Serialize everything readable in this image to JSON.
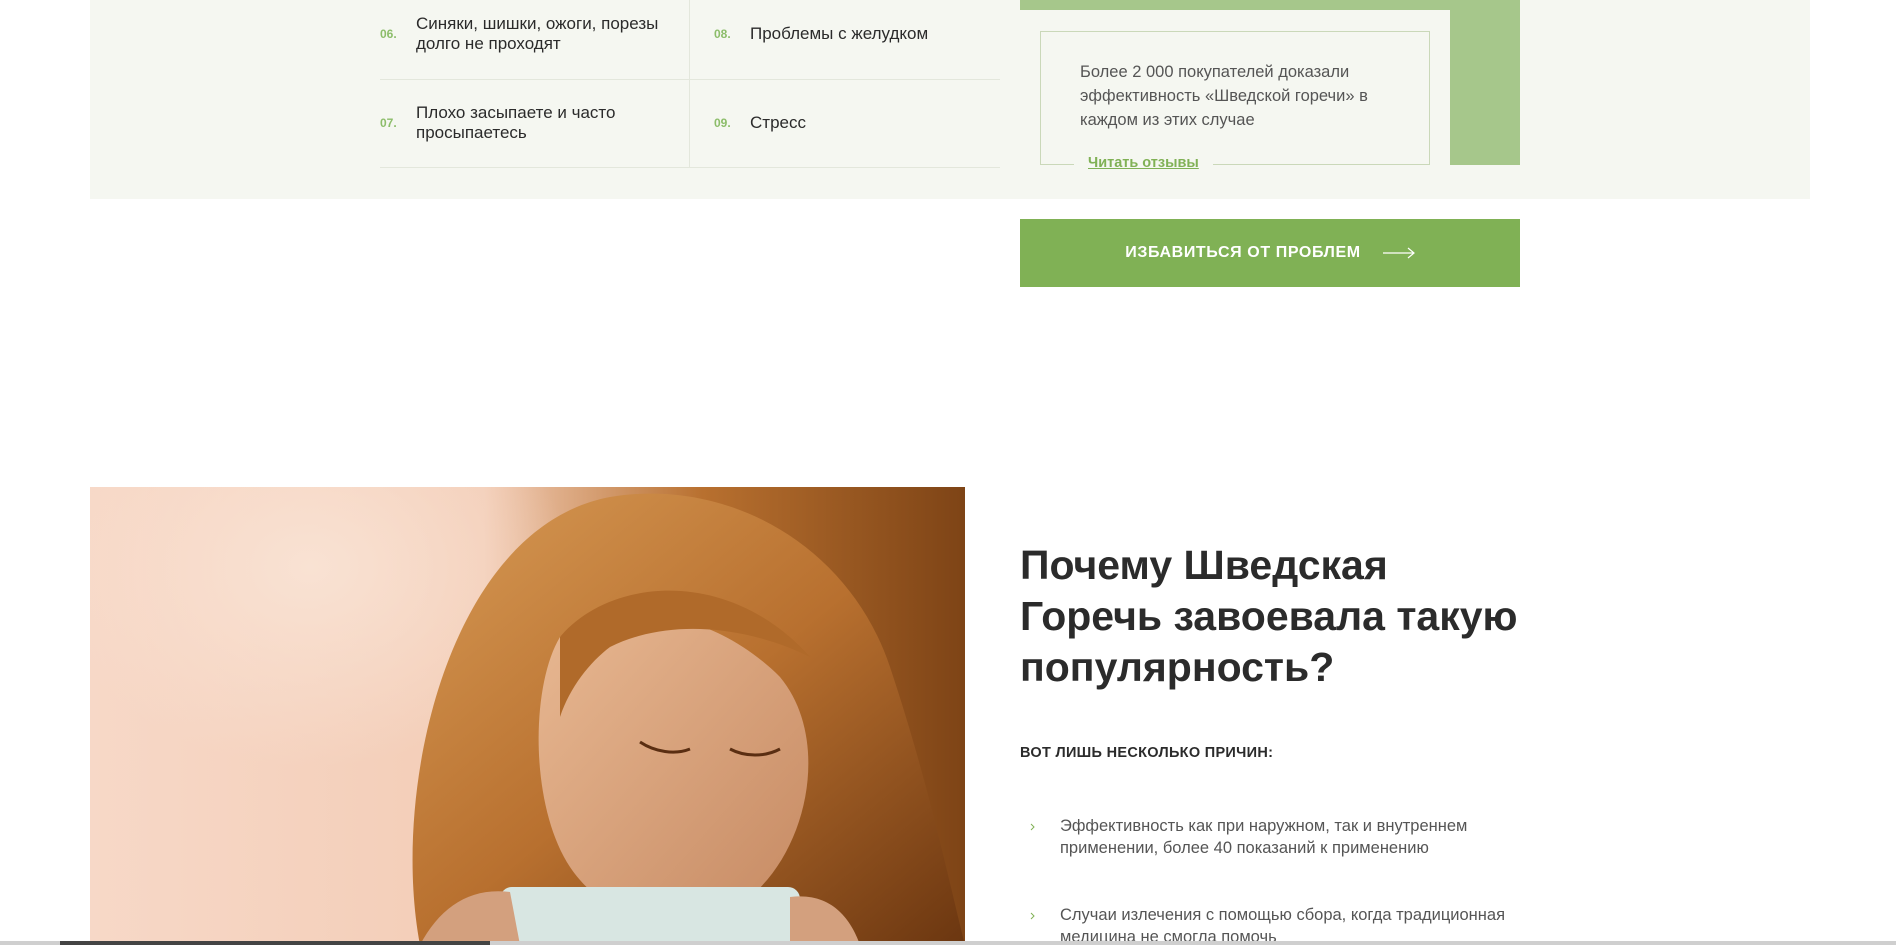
{
  "problems": [
    {
      "num": "06.",
      "text": "Синяки, шишки, ожоги, порезы долго не проходят"
    },
    {
      "num": "07.",
      "text": "Плохо засыпаете и часто просыпаетесь"
    },
    {
      "num": "08.",
      "text": "Проблемы с желудком"
    },
    {
      "num": "09.",
      "text": "Стресс"
    }
  ],
  "testimonial": {
    "text": "Более 2 000 покупателей доказали эффективность «Шведской горечи» в каждом из этих случае",
    "link": "Читать отзывы"
  },
  "cta": {
    "label": "ИЗБАВИТЬСЯ ОТ ПРОБЛЕМ",
    "icon": "arrow-right-icon"
  },
  "popularity": {
    "heading": "Почему Шведская Горечь завоевала такую популярность?",
    "subheading": "ВОТ ЛИШЬ НЕСКОЛЬКО ПРИЧИН:",
    "reasons": [
      "Эффективность как при наружном, так и внутреннем применении, более 40 показаний к применению",
      "Случаи излечения с помощью сбора, когда традиционная медицина не смогла помочь"
    ]
  },
  "colors": {
    "accent": "#80b155",
    "band": "#f5f7f1",
    "deco": "#a6c78b"
  }
}
